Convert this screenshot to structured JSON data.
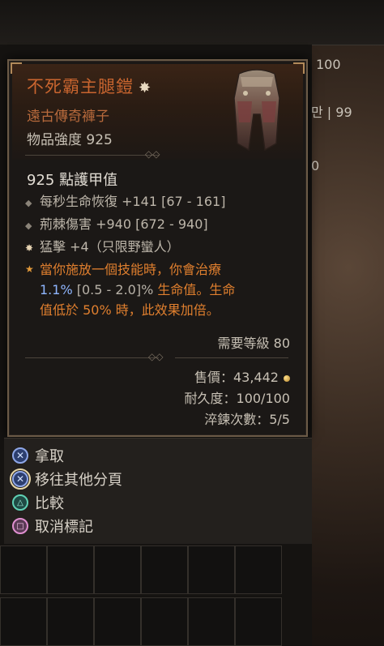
{
  "tooltip": {
    "title": "不死霸主腿鎧",
    "subtype": "遠古傳奇褲子",
    "item_power": "物品強度 925",
    "armor": "925 點護甲值",
    "affixes": [
      {
        "text": "每秒生命恢復 +141 [67 - 161]",
        "icon": "diamond-bullet-icon"
      },
      {
        "text": "荊棘傷害 +940 [672 - 940]",
        "icon": "diamond-bullet-icon"
      },
      {
        "text": "猛擊 +4（只限野蠻人）",
        "icon": "ancestral-star-icon"
      }
    ],
    "legendary": {
      "line1": "當你施放一個技能時，你會治療",
      "value": "1.1%",
      "range": "[0.5 - 2.0]%",
      "line2_rest": " 生命值。生命",
      "line3": "值低於 50% 時，此效果加倍。"
    },
    "required_level": "需要等級 80",
    "sell_price": "售價：43,442",
    "durability": "耐久度：100/100",
    "temper": "淬鍊次數：5/5"
  },
  "actions": [
    {
      "label": "拿取",
      "icon": "cross-button-icon"
    },
    {
      "label": "移往其他分頁",
      "icon": "cross-button-hold-icon"
    },
    {
      "label": "比較",
      "icon": "triangle-button-icon"
    },
    {
      "label": "取消標記",
      "icon": "square-button-icon"
    }
  ],
  "background": {
    "right_values": [
      "100",
      "만 | 99",
      "0"
    ]
  },
  "colors": {
    "legendary_orange": "#c9652f",
    "affix_blue": "#8fb6ff",
    "border": "#6b5a47"
  }
}
